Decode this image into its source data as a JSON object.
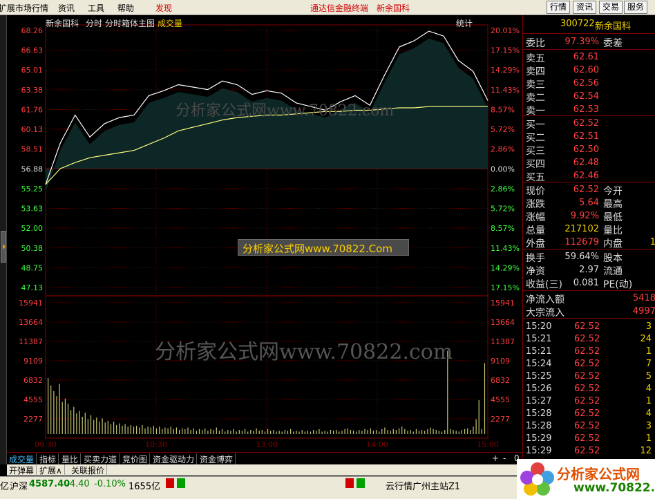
{
  "menu": {
    "items": [
      "扩展市场行情",
      "资讯",
      "工具",
      "帮助",
      "发现"
    ],
    "banner_left": "通达信金融终端",
    "banner_right": "新余国科",
    "buttons": [
      "行情",
      "资讯",
      "交易",
      "服务"
    ]
  },
  "chart_header": {
    "stock_name": "新余国科",
    "tab_intraday": "分时",
    "tab_box": "分时箱体主图",
    "tab_volume": "成交量",
    "stat_label": "统计"
  },
  "price_axis": {
    "left_labels": [
      "68.26",
      "66.63",
      "65.01",
      "63.38",
      "61.76",
      "60.13",
      "58.51",
      "56.88",
      "55.25",
      "53.63",
      "52.00",
      "50.38",
      "48.75",
      "47.13"
    ],
    "right_labels": [
      "20.01%",
      "17.15%",
      "14.29%",
      "11.43%",
      "8.57%",
      "5.72%",
      "2.86%",
      "0.00%",
      "2.86%",
      "5.72%",
      "8.57%",
      "11.43%",
      "14.29%",
      "17.15%"
    ]
  },
  "volume_axis": {
    "labels": [
      "15941",
      "13664",
      "11387",
      "9109",
      "6832",
      "4555",
      "2277"
    ]
  },
  "time_axis": {
    "labels": [
      "09:30",
      "10:30",
      "13:00",
      "14:00",
      "15:00"
    ]
  },
  "chart_data": {
    "type": "line",
    "title": "",
    "xlabel": "",
    "ylabel": "",
    "x": [
      "09:30",
      "09:35",
      "09:40",
      "09:45",
      "09:50",
      "09:55",
      "10:00",
      "10:10",
      "10:20",
      "10:30",
      "10:40",
      "10:50",
      "11:00",
      "11:10",
      "11:20",
      "11:30",
      "13:10",
      "13:20",
      "13:30",
      "13:40",
      "13:50",
      "14:00",
      "14:10",
      "14:20",
      "14:30",
      "14:35",
      "14:40",
      "14:45",
      "14:50",
      "14:55",
      "15:00"
    ],
    "series": [
      {
        "values": [
          55.6,
          59.0,
          61.3,
          59.5,
          60.6,
          61.1,
          61.3,
          62.9,
          63.3,
          63.8,
          63.6,
          63.4,
          64.1,
          63.8,
          63.0,
          63.3,
          63.1,
          62.3,
          62.0,
          61.7,
          62.4,
          62.9,
          62.1,
          64.6,
          66.9,
          67.4,
          68.2,
          67.8,
          65.8,
          64.9,
          62.5
        ]
      },
      {
        "values": [
          55.6,
          56.9,
          57.4,
          57.8,
          58.0,
          58.2,
          58.4,
          58.9,
          59.4,
          60.0,
          60.3,
          60.6,
          60.9,
          61.1,
          61.2,
          61.3,
          61.3,
          61.4,
          61.5,
          61.6,
          61.6,
          61.7,
          61.7,
          61.8,
          61.9,
          61.9,
          62.0,
          62.0,
          62.0,
          62.0,
          62.0
        ]
      }
    ],
    "ylim": [
      47.13,
      68.26
    ],
    "prev_close": 56.88
  },
  "volume_data": {
    "type": "bar",
    "values": [
      6800,
      5900,
      5200,
      4600,
      6100,
      3900,
      4300,
      3700,
      2900,
      3300,
      2500,
      2800,
      2100,
      2600,
      1800,
      2300,
      1700,
      2000,
      1500,
      1900,
      1400,
      1600,
      1200,
      1500,
      1100,
      1300,
      1000,
      1200,
      900,
      1100,
      900,
      1000,
      800,
      1100,
      700,
      900,
      800,
      1000,
      700,
      900,
      600,
      800,
      700,
      900,
      600,
      800,
      500,
      700,
      600,
      800,
      500,
      700,
      400,
      600,
      500,
      700,
      400,
      600,
      500,
      800,
      400,
      600,
      300,
      500,
      400,
      600,
      300,
      500,
      400,
      600,
      300,
      500,
      400,
      700,
      400,
      500,
      300,
      600,
      400,
      500,
      300,
      400,
      300,
      500,
      400,
      600,
      300,
      400,
      300,
      500,
      300,
      400,
      300,
      500,
      400,
      600,
      300,
      400,
      300,
      500,
      400,
      500,
      300,
      400,
      600,
      700,
      500,
      400,
      300,
      500,
      400,
      600,
      500,
      700,
      400,
      500,
      300,
      600,
      800,
      500,
      400,
      600,
      500,
      700,
      900,
      600,
      400,
      500,
      300,
      600,
      400,
      500,
      400,
      600,
      800,
      600,
      500,
      400,
      300,
      500,
      10100,
      600,
      500,
      400,
      300,
      500,
      600,
      700,
      500,
      900,
      1800,
      4100,
      600,
      8600
    ],
    "ylim": [
      0,
      15941
    ]
  },
  "quote": {
    "code": "300722",
    "name": "新余国科",
    "weibi_label": "委比",
    "weibi_value": "97.39%",
    "weicha_label": "委差",
    "asks": [
      {
        "label": "卖五",
        "price": "62.61"
      },
      {
        "label": "卖四",
        "price": "62.60"
      },
      {
        "label": "卖三",
        "price": "62.56"
      },
      {
        "label": "卖二",
        "price": "62.54"
      },
      {
        "label": "卖一",
        "price": "62.53"
      }
    ],
    "bids": [
      {
        "label": "买一",
        "price": "62.52"
      },
      {
        "label": "买二",
        "price": "62.51"
      },
      {
        "label": "买三",
        "price": "62.50"
      },
      {
        "label": "买四",
        "price": "62.48"
      },
      {
        "label": "买五",
        "price": "62.46"
      }
    ],
    "stats": [
      {
        "label": "现价",
        "value": "62.52",
        "label2": "今开",
        "color": "#ff4040"
      },
      {
        "label": "涨跌",
        "value": "5.64",
        "label2": "最高",
        "color": "#ff4040"
      },
      {
        "label": "涨幅",
        "value": "9.92%",
        "label2": "最低",
        "color": "#ff4040"
      },
      {
        "label": "总量",
        "value": "217102",
        "label2": "量比",
        "color": "#f0d000"
      },
      {
        "label": "外盘",
        "value": "112679",
        "label2": "内盘",
        "color": "#ff4040",
        "value2": "1"
      }
    ],
    "stats2": [
      {
        "label": "换手",
        "value": "59.64%",
        "label2": "股本",
        "color": "#ddd"
      },
      {
        "label": "净资",
        "value": "2.97",
        "label2": "流通",
        "color": "#ddd"
      },
      {
        "label": "收益(三)",
        "value": "0.081",
        "label2": "PE(动)",
        "color": "#ddd"
      }
    ],
    "flow": [
      {
        "label": "净流入额",
        "value": "5418"
      },
      {
        "label": "大宗流入",
        "value": "4997"
      }
    ],
    "ticks": [
      {
        "time": "15:20",
        "price": "62.52",
        "vol": "3"
      },
      {
        "time": "15:21",
        "price": "62.52",
        "vol": "24"
      },
      {
        "time": "15:21",
        "price": "62.52",
        "vol": "1"
      },
      {
        "time": "15:24",
        "price": "62.52",
        "vol": "7"
      },
      {
        "time": "15:25",
        "price": "62.52",
        "vol": "5"
      },
      {
        "time": "15:26",
        "price": "62.52",
        "vol": "4"
      },
      {
        "time": "15:27",
        "price": "62.52",
        "vol": "1"
      },
      {
        "time": "15:28",
        "price": "62.52",
        "vol": "4"
      },
      {
        "time": "15:28",
        "price": "62.52",
        "vol": "3"
      },
      {
        "time": "15:29",
        "price": "62.52",
        "vol": "1"
      },
      {
        "time": "15:29",
        "price": "62.52",
        "vol": "12"
      }
    ]
  },
  "tabs": [
    "成交量",
    "指标",
    "量比",
    "买卖力道",
    "竞价图",
    "资金驱动力",
    "资金博弈"
  ],
  "tab_controls": [
    "+",
    "-",
    "0"
  ],
  "ext_buttons": [
    "开弹幕",
    "扩展∧",
    "关联报价"
  ],
  "status": {
    "index_name": "沪深",
    "index_value": "4587.40",
    "index_change": "-4.40",
    "index_pct": "-0.10%",
    "turnover": "1655亿",
    "server": "云行情广州主站Z1",
    "left_prefix": "亿"
  },
  "watermarks": {
    "top": "分析家公式网www.70822.com",
    "middle": "分析家公式网www.70822.Com",
    "bottom": "分析家公式网www.70822.com"
  },
  "logo": {
    "title": "分析家公式网",
    "url": "www.70822.Com"
  },
  "colors": {
    "price_line": "#ffffff",
    "avg_line": "#ffff80",
    "up": "#ff4040",
    "down": "#40ff40",
    "axis_grid": "#800000",
    "volume": "#c8c870",
    "box_fill": "#0e2a2a"
  }
}
